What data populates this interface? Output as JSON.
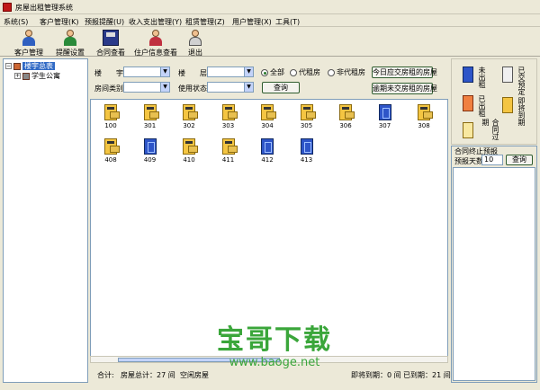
{
  "window": {
    "title": "房屋出租管理系统"
  },
  "menu": [
    "系统(S)",
    "客户管理(K)",
    "预报提醒(U)",
    "收入支出管理(Y)",
    "租赁管理(Z)",
    "用户管理(X)",
    "工具(T)"
  ],
  "toolbar": {
    "customers": "客户管理",
    "reminder": "提醒设置",
    "contracts": "合同查看",
    "tenants": "住户信息查看",
    "exit": "退出"
  },
  "tree": {
    "root": "楼宇总表",
    "child": "学生公寓"
  },
  "filters": {
    "building_label": "楼　　宇",
    "floor_label": "楼　　层",
    "room_type_label": "房间类别",
    "usage_label": "使用状态",
    "radio_all": "全部",
    "radio_agent": "代租房",
    "radio_non_agent": "非代租房",
    "due_today_button": "今日应交房租的房屋",
    "overdue_button": "逾期未交房租的房屋",
    "query_button": "查询"
  },
  "rooms": [
    {
      "num": "100",
      "status": "rented"
    },
    {
      "num": "301",
      "status": "rented"
    },
    {
      "num": "302",
      "status": "rented"
    },
    {
      "num": "303",
      "status": "rented"
    },
    {
      "num": "304",
      "status": "rented"
    },
    {
      "num": "305",
      "status": "rented"
    },
    {
      "num": "306",
      "status": "rented"
    },
    {
      "num": "307",
      "status": "vacant"
    },
    {
      "num": "308",
      "status": "rented"
    },
    {
      "num": "408",
      "status": "rented"
    },
    {
      "num": "409",
      "status": "vacant"
    },
    {
      "num": "410",
      "status": "rented"
    },
    {
      "num": "411",
      "status": "rented"
    },
    {
      "num": "412",
      "status": "vacant"
    },
    {
      "num": "413",
      "status": "vacant"
    }
  ],
  "status": {
    "total_label": "合计:",
    "total_rooms": "房屋总计：27 间",
    "vacant_partial": "空闲房屋",
    "expiring": "即将到期：0 间",
    "expired": "已到期：21 间"
  },
  "legend": {
    "vacant": "未出租",
    "rented": "已出租",
    "prepaid": "已交预定",
    "expiring": "即将到期",
    "expired": "合同过期"
  },
  "contract": {
    "title": "合同终止预报",
    "days_label": "预报天数",
    "days_value": "10",
    "query_button": "查询"
  },
  "watermark": {
    "big": "宝哥下载",
    "small": "www.baoge.net"
  },
  "colors": {
    "rented": "#f4c542",
    "vacant": "#2e55c8",
    "watermark": "#3aa63a",
    "selection": "#316ac5"
  }
}
